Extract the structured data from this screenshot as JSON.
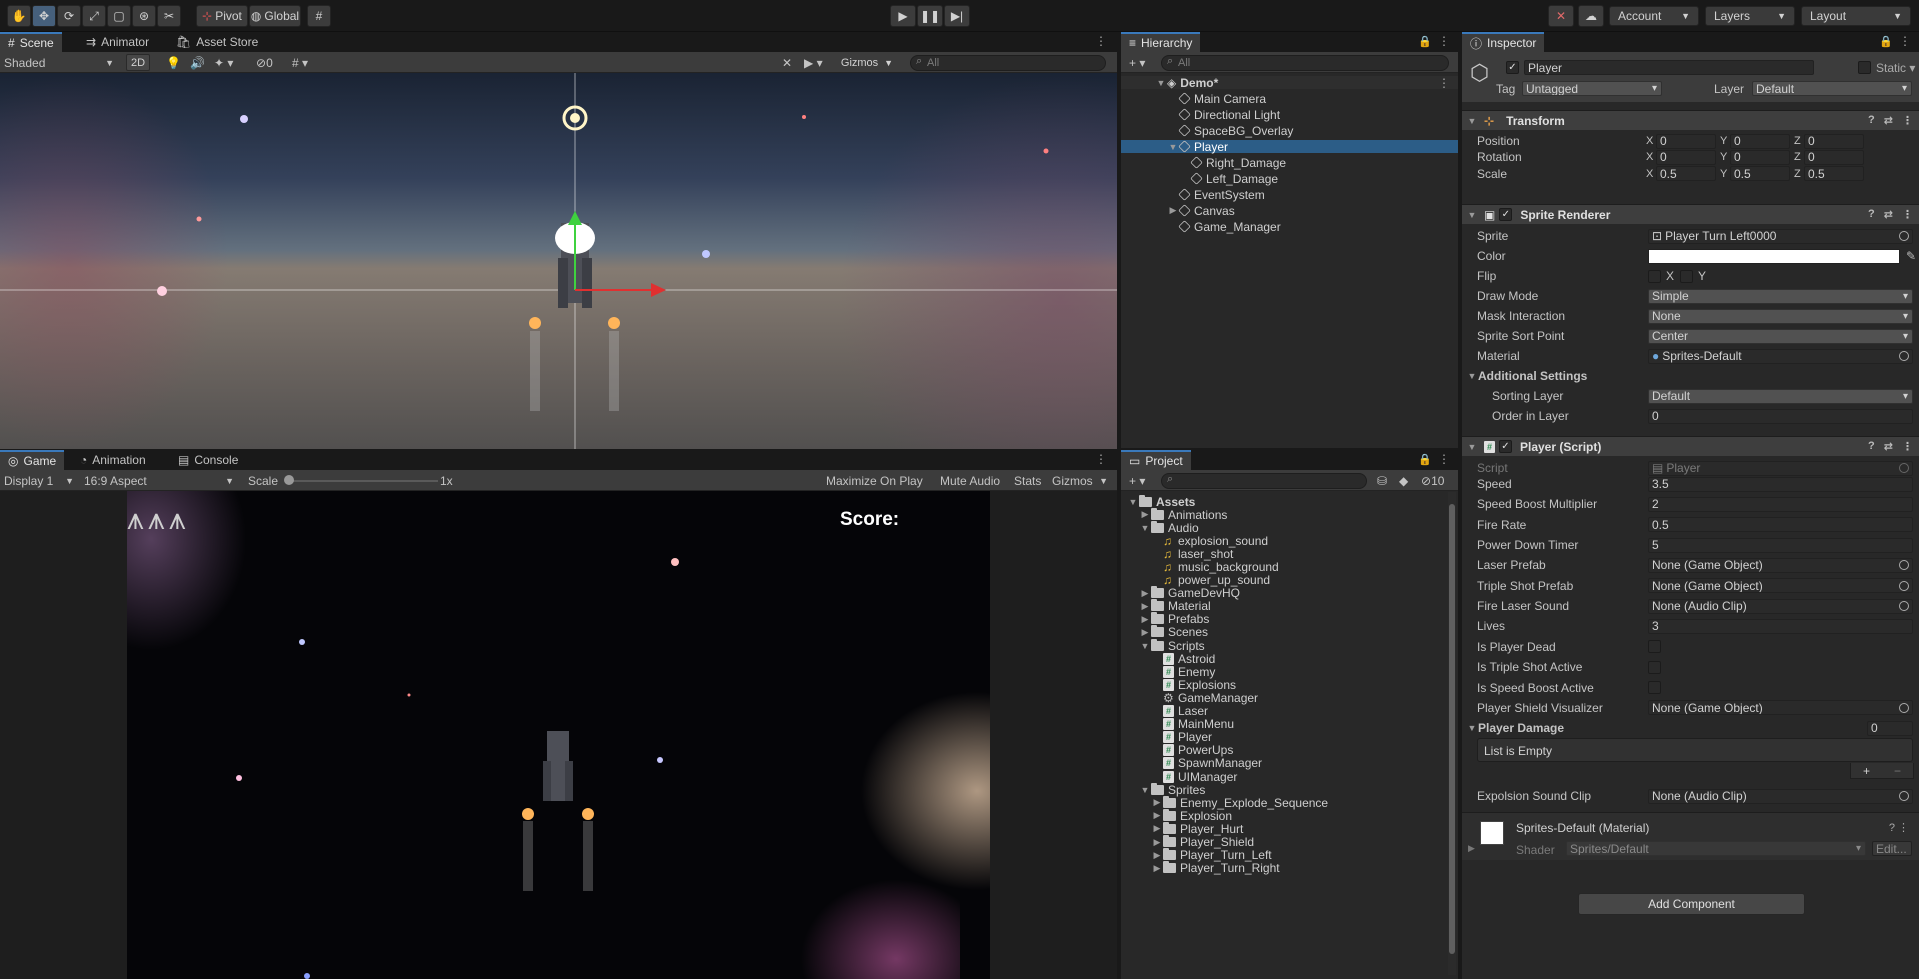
{
  "toolbar": {
    "pivot": "Pivot",
    "global": "Global",
    "account": "Account",
    "layers": "Layers",
    "layout": "Layout"
  },
  "scene": {
    "tabs": [
      "Scene",
      "Animator",
      "Asset Store"
    ],
    "shading": "Shaded",
    "mode2d": "2D",
    "hidden_count": "0",
    "gizmos": "Gizmos",
    "search_placeholder": "All"
  },
  "game": {
    "tabs": [
      "Game",
      "Animation",
      "Console"
    ],
    "display": "Display 1",
    "aspect": "16:9 Aspect",
    "scale_label": "Scale",
    "scale_value": "1x",
    "maximize": "Maximize On Play",
    "mute": "Mute Audio",
    "stats": "Stats",
    "gizmos": "Gizmos",
    "score_label": "Score:",
    "lives_shown": 3
  },
  "hierarchy": {
    "title": "Hierarchy",
    "search_placeholder": "All",
    "scene_name": "Demo*",
    "items": [
      {
        "label": "Main Camera",
        "depth": 1,
        "fold": ""
      },
      {
        "label": "Directional Light",
        "depth": 1,
        "fold": ""
      },
      {
        "label": "SpaceBG_Overlay",
        "depth": 1,
        "fold": ""
      },
      {
        "label": "Player",
        "depth": 1,
        "fold": "▼",
        "selected": true
      },
      {
        "label": "Right_Damage",
        "depth": 2,
        "fold": ""
      },
      {
        "label": "Left_Damage",
        "depth": 2,
        "fold": ""
      },
      {
        "label": "EventSystem",
        "depth": 1,
        "fold": ""
      },
      {
        "label": "Canvas",
        "depth": 1,
        "fold": "▶"
      },
      {
        "label": "Game_Manager",
        "depth": 1,
        "fold": ""
      }
    ]
  },
  "project": {
    "title": "Project",
    "hidden_count": "10",
    "root": "Assets",
    "items": [
      {
        "label": "Animations",
        "type": "folder",
        "depth": 1,
        "fold": "▶"
      },
      {
        "label": "Audio",
        "type": "folder",
        "depth": 1,
        "fold": "▼"
      },
      {
        "label": "explosion_sound",
        "type": "audio",
        "depth": 2,
        "fold": ""
      },
      {
        "label": "laser_shot",
        "type": "audio",
        "depth": 2,
        "fold": ""
      },
      {
        "label": "music_background",
        "type": "audio",
        "depth": 2,
        "fold": ""
      },
      {
        "label": "power_up_sound",
        "type": "audio",
        "depth": 2,
        "fold": ""
      },
      {
        "label": "GameDevHQ",
        "type": "folder",
        "depth": 1,
        "fold": "▶"
      },
      {
        "label": "Material",
        "type": "folder",
        "depth": 1,
        "fold": "▶"
      },
      {
        "label": "Prefabs",
        "type": "folder",
        "depth": 1,
        "fold": "▶"
      },
      {
        "label": "Scenes",
        "type": "folder",
        "depth": 1,
        "fold": "▶"
      },
      {
        "label": "Scripts",
        "type": "folder",
        "depth": 1,
        "fold": "▼"
      },
      {
        "label": "Astroid",
        "type": "script",
        "depth": 2,
        "fold": ""
      },
      {
        "label": "Enemy",
        "type": "script",
        "depth": 2,
        "fold": ""
      },
      {
        "label": "Explosions",
        "type": "script",
        "depth": 2,
        "fold": ""
      },
      {
        "label": "GameManager",
        "type": "gear",
        "depth": 2,
        "fold": ""
      },
      {
        "label": "Laser",
        "type": "script",
        "depth": 2,
        "fold": ""
      },
      {
        "label": "MainMenu",
        "type": "script",
        "depth": 2,
        "fold": ""
      },
      {
        "label": "Player",
        "type": "script",
        "depth": 2,
        "fold": ""
      },
      {
        "label": "PowerUps",
        "type": "script",
        "depth": 2,
        "fold": ""
      },
      {
        "label": "SpawnManager",
        "type": "script",
        "depth": 2,
        "fold": ""
      },
      {
        "label": "UIManager",
        "type": "script",
        "depth": 2,
        "fold": ""
      },
      {
        "label": "Sprites",
        "type": "folder",
        "depth": 1,
        "fold": "▼"
      },
      {
        "label": "Enemy_Explode_Sequence",
        "type": "folder",
        "depth": 2,
        "fold": "▶"
      },
      {
        "label": "Explosion",
        "type": "folder",
        "depth": 2,
        "fold": "▶"
      },
      {
        "label": "Player_Hurt",
        "type": "folder",
        "depth": 2,
        "fold": "▶"
      },
      {
        "label": "Player_Shield",
        "type": "folder",
        "depth": 2,
        "fold": "▶"
      },
      {
        "label": "Player_Turn_Left",
        "type": "folder",
        "depth": 2,
        "fold": "▶"
      },
      {
        "label": "Player_Turn_Right",
        "type": "folder",
        "depth": 2,
        "fold": "▶"
      }
    ]
  },
  "inspector": {
    "title": "Inspector",
    "object_name": "Player",
    "static_label": "Static",
    "tag_label": "Tag",
    "tag_value": "Untagged",
    "layer_label": "Layer",
    "layer_value": "Default",
    "transform": {
      "title": "Transform",
      "rows": [
        {
          "label": "Position",
          "x": "0",
          "y": "0",
          "z": "0"
        },
        {
          "label": "Rotation",
          "x": "0",
          "y": "0",
          "z": "0"
        },
        {
          "label": "Scale",
          "x": "0.5",
          "y": "0.5",
          "z": "0.5"
        }
      ]
    },
    "sprite_renderer": {
      "title": "Sprite Renderer",
      "sprite_label": "Sprite",
      "sprite_value": "Player Turn Left0000",
      "color_label": "Color",
      "flip_label": "Flip",
      "flip_x": "X",
      "flip_y": "Y",
      "draw_mode_label": "Draw Mode",
      "draw_mode_value": "Simple",
      "mask_label": "Mask Interaction",
      "mask_value": "None",
      "sort_point_label": "Sprite Sort Point",
      "sort_point_value": "Center",
      "material_label": "Material",
      "material_value": "Sprites-Default",
      "additional": "Additional Settings",
      "sorting_layer_label": "Sorting Layer",
      "sorting_layer_value": "Default",
      "order_label": "Order in Layer",
      "order_value": "0"
    },
    "player_script": {
      "title": "Player (Script)",
      "script_label": "Script",
      "script_value": "Player",
      "fields": [
        {
          "label": "Speed",
          "value": "3.5",
          "kind": "text"
        },
        {
          "label": "Speed Boost Multiplier",
          "value": "2",
          "kind": "text"
        },
        {
          "label": "Fire Rate",
          "value": "0.5",
          "kind": "text"
        },
        {
          "label": "Power Down Timer",
          "value": "5",
          "kind": "text"
        },
        {
          "label": "Laser Prefab",
          "value": "None (Game Object)",
          "kind": "object"
        },
        {
          "label": "Triple Shot Prefab",
          "value": "None (Game Object)",
          "kind": "object"
        },
        {
          "label": "Fire Laser Sound",
          "value": "None (Audio Clip)",
          "kind": "object"
        },
        {
          "label": "Lives",
          "value": "3",
          "kind": "text"
        },
        {
          "label": "Is Player Dead",
          "value": "",
          "kind": "check"
        },
        {
          "label": "Is Triple Shot Active",
          "value": "",
          "kind": "check"
        },
        {
          "label": "Is Speed Boost Active",
          "value": "",
          "kind": "check"
        },
        {
          "label": "Player Shield Visualizer",
          "value": "None (Game Object)",
          "kind": "object"
        }
      ],
      "player_damage_label": "Player Damage",
      "player_damage_count": "0",
      "list_empty": "List is Empty",
      "explosion_label": "Expolsion Sound Clip",
      "explosion_value": "None (Audio Clip)"
    },
    "material": {
      "title": "Sprites-Default (Material)",
      "shader_label": "Shader",
      "shader_value": "Sprites/Default",
      "edit": "Edit..."
    },
    "add_component": "Add Component"
  },
  "colors": {
    "selection": "#2c5d87",
    "accent": "#3a79bb"
  }
}
